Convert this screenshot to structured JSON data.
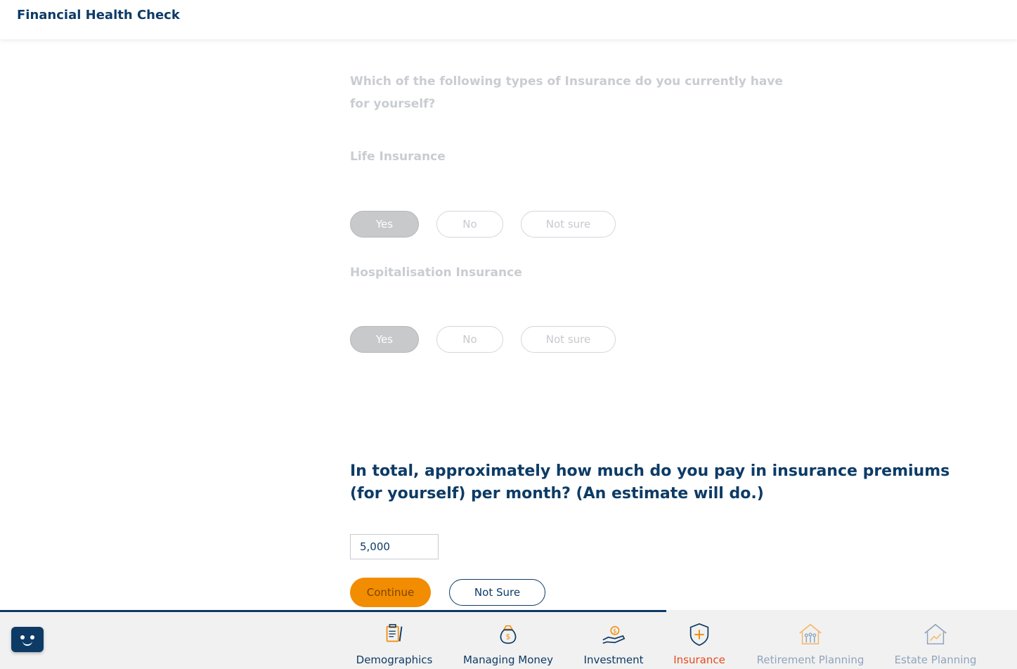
{
  "header": {
    "title": "Financial Health Check"
  },
  "question1": {
    "text": "Which of the following types of Insurance do you currently have for yourself?",
    "items": [
      {
        "label": "Life Insurance",
        "options": [
          "Yes",
          "No",
          "Not sure"
        ],
        "selected": "Yes"
      },
      {
        "label": "Hospitalisation Insurance",
        "options": [
          "Yes",
          "No",
          "Not sure"
        ],
        "selected": "Yes"
      }
    ]
  },
  "question2": {
    "text": "In total, approximately how much do you pay in insurance premiums (for yourself) per month? (An estimate will do.)",
    "amount_value": "5,000"
  },
  "actions": {
    "continue_label": "Continue",
    "not_sure_label": "Not Sure"
  },
  "progress": {
    "fraction": 0.655
  },
  "nav": {
    "items": [
      {
        "label": "Demographics",
        "state": "done",
        "icon": "clipboard-pen-icon"
      },
      {
        "label": "Managing Money",
        "state": "done",
        "icon": "money-bag-icon"
      },
      {
        "label": "Investment",
        "state": "done",
        "icon": "hand-money-icon"
      },
      {
        "label": "Insurance",
        "state": "active",
        "icon": "shield-plus-icon"
      },
      {
        "label": "Retirement Planning",
        "state": "future",
        "icon": "house-family-icon"
      },
      {
        "label": "Estate Planning",
        "state": "future",
        "icon": "house-chart-icon"
      }
    ]
  },
  "colors": {
    "navy": "#0d3b66",
    "orange": "#f28c00",
    "active": "#e8491d",
    "future": "#8fa4bd"
  }
}
